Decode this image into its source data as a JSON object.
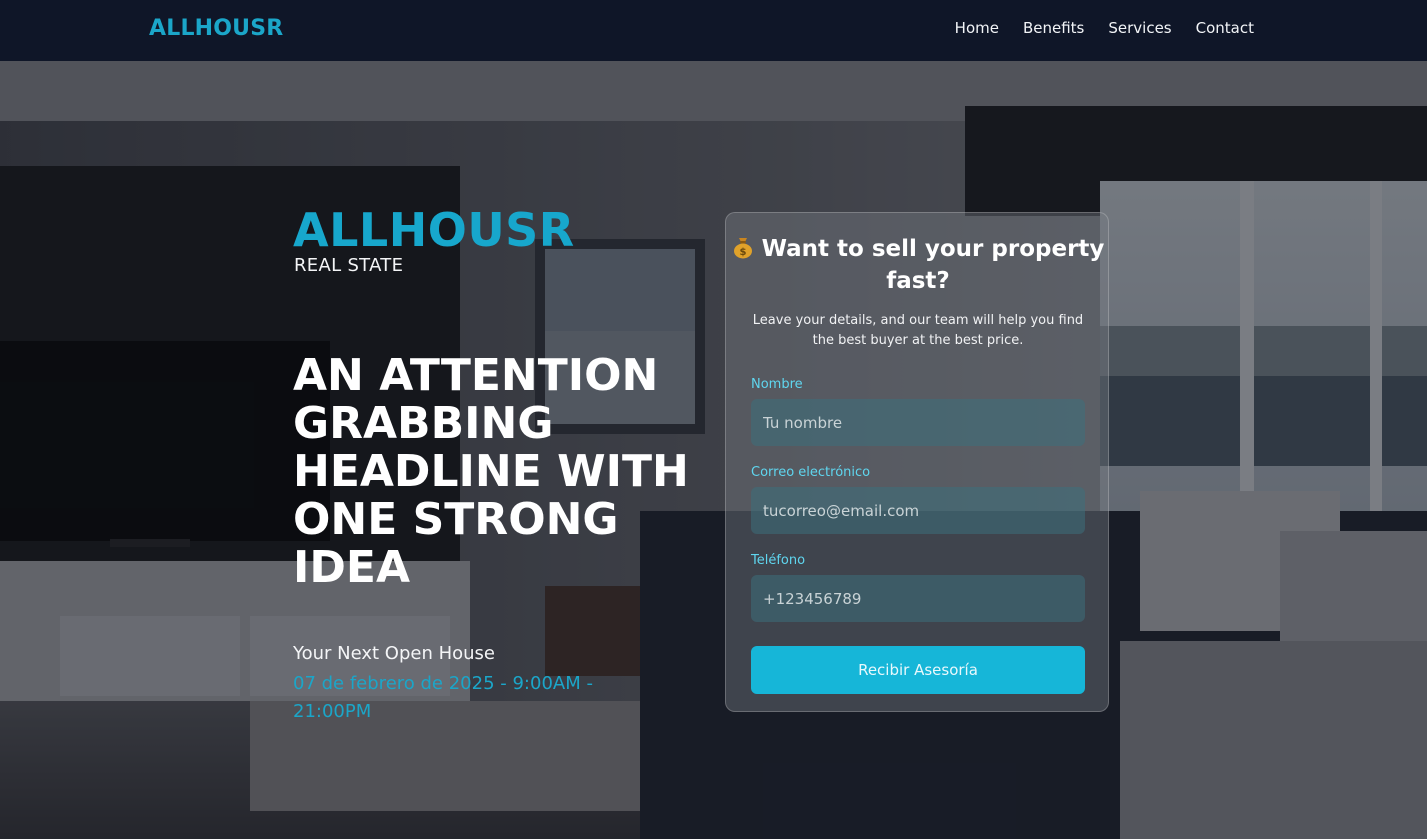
{
  "nav": {
    "logo": "ALLHOUSR",
    "links": [
      "Home",
      "Benefits",
      "Services",
      "Contact"
    ]
  },
  "hero": {
    "brand": "ALLHOUSR",
    "brand_sub": "REAL STATE",
    "headline": "AN ATTENTION GRABBING HEADLINE WITH ONE STRONG IDEA",
    "open_house_label": "Your Next Open House",
    "open_house_date": "07 de febrero de 2025 - 9:00AM - 21:00PM"
  },
  "form": {
    "title": "Want to sell your property fast?",
    "title_icon": "money-bag-icon",
    "description": "Leave your details, and our team will help you find the best buyer at the best price.",
    "fields": [
      {
        "label": "Nombre",
        "placeholder": "Tu nombre"
      },
      {
        "label": "Correo electrónico",
        "placeholder": "tucorreo@email.com"
      },
      {
        "label": "Teléfono",
        "placeholder": "+123456789"
      }
    ],
    "submit_label": "Recibir Asesoría"
  },
  "colors": {
    "accent": "#17a7cc",
    "nav_bg": "#0f1628",
    "button": "#16b6d8",
    "label": "#5fd6ef"
  }
}
